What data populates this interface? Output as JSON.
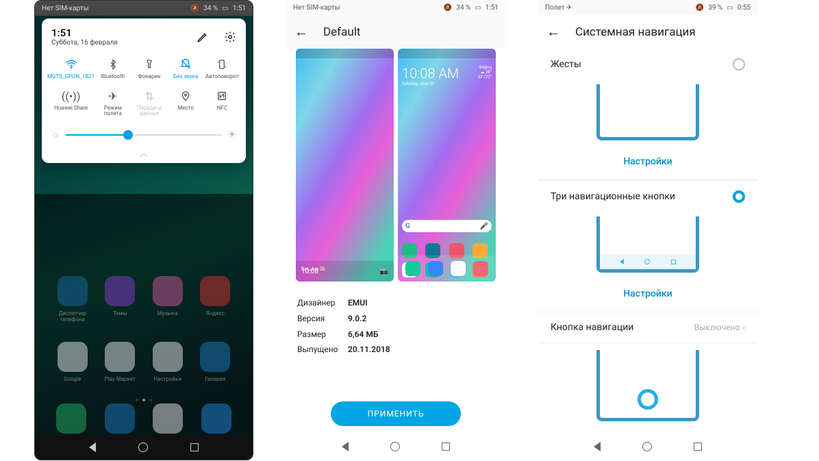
{
  "phone1": {
    "status": {
      "left": "Нет SIM-карты",
      "right_icon": "🔕",
      "battery": "34 %",
      "time": "1:51"
    },
    "qs": {
      "time": "1:51",
      "date": "Суббота, 16 февраля",
      "tiles": [
        {
          "name": "wifi",
          "label": "MGTS_GPON_1B21",
          "active": true
        },
        {
          "name": "bluetooth",
          "label": "Bluetooth"
        },
        {
          "name": "flashlight",
          "label": "Фонарик"
        },
        {
          "name": "silent",
          "label": "Без звука",
          "active": true
        },
        {
          "name": "autorotate",
          "label": "Автоповорот"
        },
        {
          "name": "huaweishare",
          "label": "Huawei Share"
        },
        {
          "name": "airplane",
          "label": "Режим полета"
        },
        {
          "name": "mobiledata",
          "label": "Передача данных",
          "disabled": true
        },
        {
          "name": "location",
          "label": "Место"
        },
        {
          "name": "nfc",
          "label": "NFC"
        }
      ],
      "brightness_pct": 40
    },
    "home_apps": [
      {
        "label": "Диспетчер телефона",
        "bg": "#1e6db4"
      },
      {
        "label": "Темы",
        "bg": "#9b3adf"
      },
      {
        "label": "Музыка",
        "bg": "#e95aa8"
      },
      {
        "label": "Яндекс",
        "bg": "#e33"
      },
      {
        "label": "Google",
        "bg": "#fff"
      },
      {
        "label": "Play Маркет",
        "bg": "#fff"
      },
      {
        "label": "Настройки",
        "bg": "#fff"
      },
      {
        "label": "Галерея",
        "bg": "#1f86d4"
      }
    ],
    "dock": [
      {
        "bg": "#27c46a"
      },
      {
        "bg": "#1f86d4"
      },
      {
        "bg": "#fff"
      },
      {
        "bg": "#2196f3"
      }
    ]
  },
  "phone2": {
    "status": {
      "left": "Нет SIM-карты",
      "right_icon": "🔕",
      "battery": "34 %",
      "time": "1:51"
    },
    "title": "Default",
    "preview_time": "10:08",
    "preview_date": "Sat, Jun 30",
    "widget_time": "10:08 AM",
    "widget_loc": "Beijing",
    "widget_temp": "28°",
    "widget_range": "32°/22°",
    "widget_day": "Saturday, June 30",
    "search": "G",
    "meta": {
      "designer_k": "Дизайнер",
      "designer_v": "EMUI",
      "version_k": "Версия",
      "version_v": "9.0.2",
      "size_k": "Размер",
      "size_v": "6,64 МБ",
      "released_k": "Выпущено",
      "released_v": "20.11.2018"
    },
    "apply": "ПРИМЕНИТЬ"
  },
  "phone3": {
    "status": {
      "left": "Полет ✈",
      "right_icon": "🔕",
      "battery": "39 %",
      "time": "0:55"
    },
    "title": "Системная навигация",
    "opt_gestures": "Жесты",
    "link_settings": "Настройки",
    "opt_threekeys": "Три навигационные кнопки",
    "navdock_label": "Кнопка навигации",
    "navdock_value": "Выключено"
  }
}
